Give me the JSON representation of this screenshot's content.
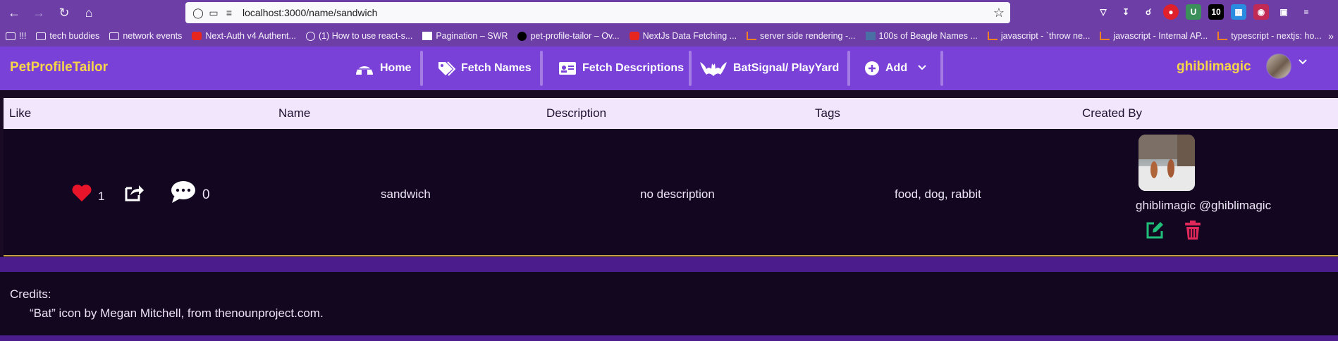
{
  "browser": {
    "url": "localhost:3000/name/sandwich",
    "bookmarks": [
      {
        "label": "!!!",
        "icon": "folder-icon"
      },
      {
        "label": "tech buddies",
        "icon": "folder-icon"
      },
      {
        "label": "network events",
        "icon": "folder-icon"
      },
      {
        "label": "Next-Auth v4 Authent...",
        "icon": "youtube-icon"
      },
      {
        "label": "(1) How to use react-s...",
        "icon": "globe-icon"
      },
      {
        "label": "Pagination – SWR",
        "icon": "swr-icon"
      },
      {
        "label": "pet-profile-tailor – Ov...",
        "icon": "vercel-icon"
      },
      {
        "label": "NextJs Data Fetching ...",
        "icon": "youtube-icon"
      },
      {
        "label": "server side rendering -...",
        "icon": "stackoverflow-icon"
      },
      {
        "label": "100s of Beagle Names ...",
        "icon": "beagle-icon"
      },
      {
        "label": "javascript - `throw ne...",
        "icon": "stackoverflow-icon"
      },
      {
        "label": "javascript - Internal AP...",
        "icon": "stackoverflow-icon"
      },
      {
        "label": "typescript - nextjs: ho...",
        "icon": "stackoverflow-icon"
      }
    ]
  },
  "app": {
    "brand": "PetProfileTailor",
    "nav": {
      "home": "Home",
      "fetch_names": "Fetch Names",
      "fetch_descriptions": "Fetch Descriptions",
      "batsignal": "BatSignal/ PlayYard",
      "add": "Add"
    },
    "user": {
      "name": "ghiblimagic"
    }
  },
  "table": {
    "headers": {
      "like": "Like",
      "name": "Name",
      "description": "Description",
      "tags": "Tags",
      "created_by": "Created By"
    },
    "row": {
      "likes": "1",
      "comments": "0",
      "name": "sandwich",
      "description": "no description",
      "tags": "food, dog, rabbit",
      "creator": "ghiblimagic @ghiblimagic"
    }
  },
  "footer": {
    "credits_title": "Credits:",
    "credits_line": "“Bat” icon by Megan Mitchell, from thenounproject.com."
  },
  "colors": {
    "nav_bg": "#7a41d9",
    "brand_yellow": "#f6d54a",
    "header_bg": "#f1e6fb",
    "row_bg": "#130620",
    "like_red": "#e8142a",
    "edit_green": "#1fbf7a",
    "delete_red": "#e0285a"
  }
}
